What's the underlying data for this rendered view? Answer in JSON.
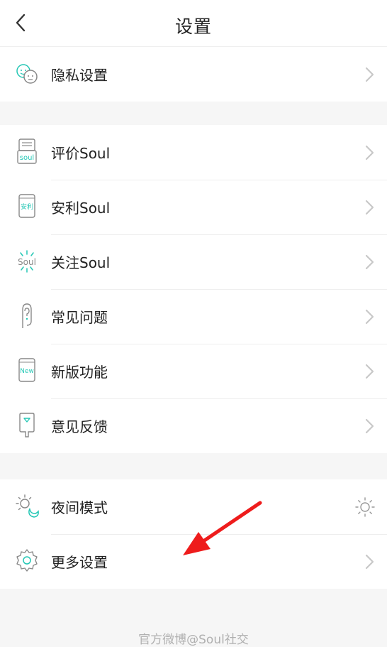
{
  "header": {
    "title": "设置"
  },
  "group1": [
    {
      "label": "隐私设置",
      "icon": "privacy-faces-icon"
    }
  ],
  "group2": [
    {
      "label": "评价Soul",
      "icon": "rate-soul-icon"
    },
    {
      "label": "安利Soul",
      "icon": "recommend-soul-icon"
    },
    {
      "label": "关注Soul",
      "icon": "follow-soul-icon"
    },
    {
      "label": "常见问题",
      "icon": "faq-icon"
    },
    {
      "label": "新版功能",
      "icon": "new-features-icon"
    },
    {
      "label": "意见反馈",
      "icon": "feedback-icon"
    }
  ],
  "group3": [
    {
      "label": "夜间模式",
      "icon": "night-mode-icon"
    },
    {
      "label": "更多设置",
      "icon": "more-settings-icon"
    }
  ],
  "badges": {
    "rate": "soul",
    "recommend": "安利",
    "follow": "Soul",
    "new": "New"
  },
  "footer": {
    "text": "官方微博@Soul社交"
  },
  "colors": {
    "accent": "#25c7b5",
    "annotation": "#ee1c1c"
  }
}
